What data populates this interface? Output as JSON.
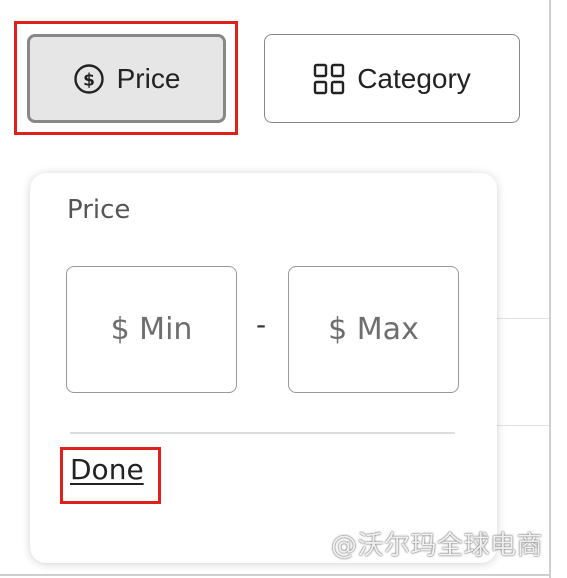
{
  "filters": {
    "price_chip": {
      "label": "Price",
      "icon": "dollar-circle-icon",
      "selected": true
    },
    "category_chip": {
      "label": "Category",
      "icon": "grid-icon",
      "selected": false
    }
  },
  "price_panel": {
    "title": "Price",
    "min_placeholder": "$ Min",
    "max_placeholder": "$ Max",
    "separator": "-",
    "done_label": "Done"
  },
  "watermark": "@沃尔玛全球电商",
  "colors": {
    "highlight": "#e0201a",
    "selected_chip_bg": "#e6e6e6",
    "border": "#888888"
  }
}
